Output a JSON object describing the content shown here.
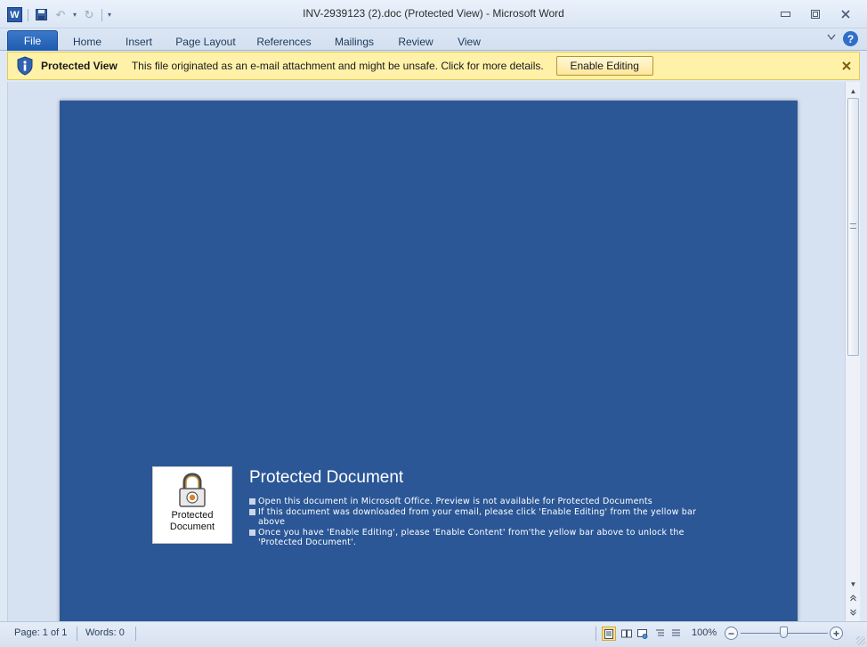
{
  "window": {
    "title": "INV-2939123 (2).doc (Protected View)  -  Microsoft Word",
    "app_icon_letter": "W",
    "minimize": "–",
    "restore": "□",
    "close": "✕"
  },
  "quick_access": {
    "save": "💾",
    "undo": "↶",
    "redo": "↻",
    "customize": "▾"
  },
  "ribbon": {
    "tabs": [
      "File",
      "Home",
      "Insert",
      "Page Layout",
      "References",
      "Mailings",
      "Review",
      "View"
    ],
    "minimize_icon": "♡",
    "help": "?"
  },
  "message_bar": {
    "title": "Protected View",
    "text": "This file originated as an e-mail attachment and might be unsafe. Click for more details.",
    "button": "Enable Editing",
    "close": "✕",
    "colors": {
      "background": "#fff1a8",
      "border": "#e3c957"
    }
  },
  "document": {
    "page_color": "#2b5797",
    "lock_label_line1": "Protected",
    "lock_label_line2": "Document",
    "heading": "Protected Document",
    "bullets": [
      "Open this document in Microsoft Office. Preview is not available for Protected Documents",
      "If this document was downloaded from your email, please click 'Enable Editing' from the yellow bar above",
      "Once you have 'Enable Editing', please 'Enable Content' from'the yellow bar above to unlock the 'Protected Document'."
    ]
  },
  "status_bar": {
    "page": "Page: 1 of 1",
    "words": "Words: 0",
    "zoom": "100%",
    "zoom_out": "−",
    "zoom_in": "+",
    "zoom_level": 1.0
  }
}
